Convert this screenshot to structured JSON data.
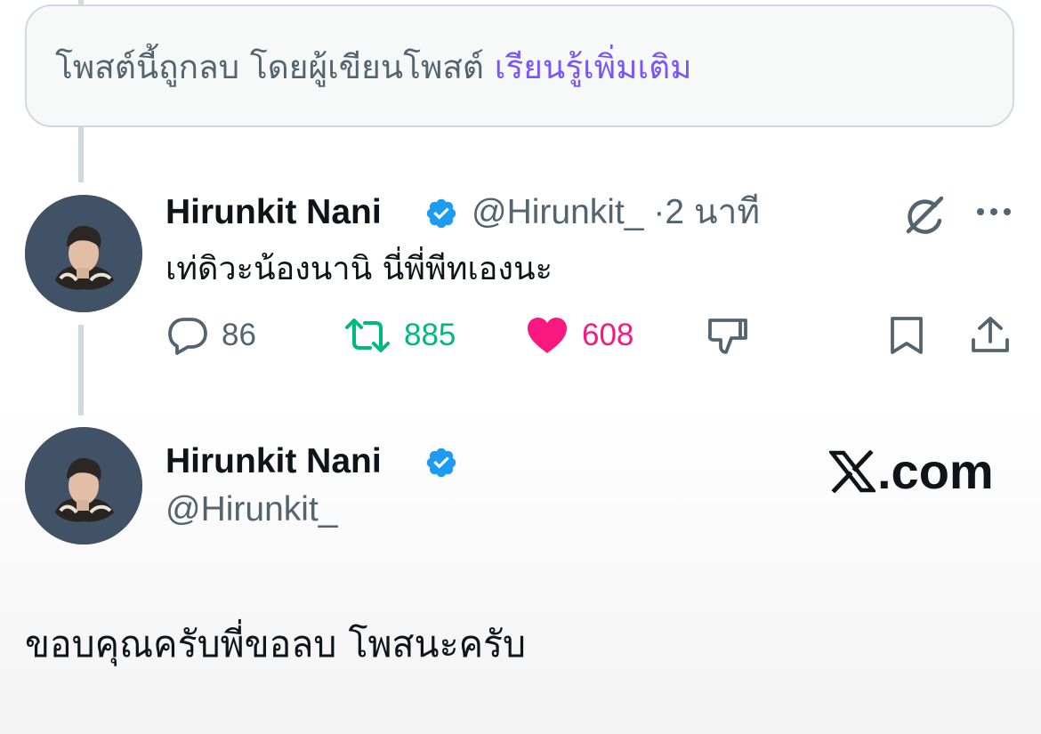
{
  "deleted_notice": {
    "text": "โพสต์นี้ถูกลบ โดยผู้เขียนโพสต์",
    "link": "เรียนรู้เพิ่มเติม"
  },
  "reply": {
    "display_name": "Hirunkit Nani",
    "handle": "@Hirunkit_",
    "separator": "·",
    "time": "2 นาที",
    "text": "เท่ดิวะน้องนานิ นี่พี่พีทเองนะ",
    "replies": "86",
    "reposts": "885",
    "likes": "608",
    "icons": {
      "grok": "grok-icon",
      "more": "more-icon",
      "reply": "reply-icon",
      "repost": "repost-icon",
      "like": "heart-icon",
      "dislike": "dislike-icon",
      "bookmark": "bookmark-icon",
      "share": "share-icon"
    }
  },
  "main_post": {
    "display_name": "Hirunkit Nani",
    "handle": "@Hirunkit_",
    "text": "ขอบคุณครับพี่ขอลบ โพสนะครับ"
  },
  "watermark": {
    "domain": ".com"
  },
  "colors": {
    "accent": "#7856ff",
    "verified": "#1d9bf0",
    "repost": "#00ba7c",
    "like": "#f91880",
    "secondary_text": "#536471",
    "avatar_bg": "#425266"
  }
}
